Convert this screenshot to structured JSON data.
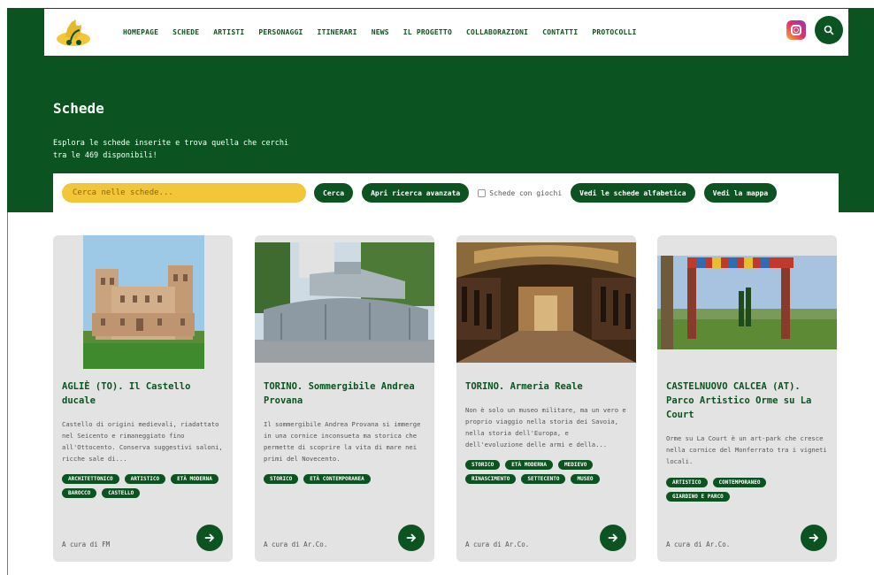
{
  "nav": {
    "items": [
      "HOMEPAGE",
      "SCHEDE",
      "ARTISTI",
      "PERSONAGGI",
      "ITINERARI",
      "NEWS",
      "IL PROGETTO",
      "COLLABORAZIONI",
      "CONTATTI",
      "PROTOCOLLI"
    ]
  },
  "hero": {
    "title": "Schede",
    "description": "Esplora le schede inserite e trova quella che cerchi tra le 469 disponibili!"
  },
  "toolbar": {
    "search_placeholder": "Cerca nelle schede...",
    "search_button": "Cerca",
    "advanced_button": "Apri ricerca avanzata",
    "checkbox_label": "Schede con giochi",
    "alpha_button": "Vedi le schede alfabetica",
    "map_button": "Vedi la mappa"
  },
  "cards": [
    {
      "title": "AGLIÈ (TO). Il Castello ducale",
      "text": "Castello di origini medievali, riadattato nel Seicento e rimaneggiato fino all'Ottocento. Conserva suggestivi saloni, ricche sale di...",
      "tags": [
        "ARCHITETTONICO",
        "ARTISTICO",
        "ETÀ MODERNA",
        "BAROCCO",
        "CASTELLO"
      ],
      "author": "A cura di FM"
    },
    {
      "title": "TORINO. Sommergibile Andrea Provana",
      "text": "Il sommergibile Andrea Provana si immerge in una cornice inconsueta ma storica che permette di scoprire la vita di mare nei primi del Novecento.",
      "tags": [
        "STORICO",
        "ETÀ CONTEMPORANEA"
      ],
      "author": "A cura di Ar.Co."
    },
    {
      "title": "TORINO. Armeria Reale",
      "text": "Non è solo un museo militare, ma un vero e proprio viaggio nella storia dei Savoia, nella storia dell'Europa, e dell'evoluzione delle armi e della...",
      "tags": [
        "STORICO",
        "ETÀ MODERNA",
        "MEDIEVO",
        "RINASCIMENTO",
        "SETTECENTO",
        "MUSEO"
      ],
      "author": "A cura di Ar.Co."
    },
    {
      "title": "CASTELNUOVO CALCEA (AT). Parco Artistico Orme su La Court",
      "text": "Orme su La Court è un art-park che cresce nella cornice del Monferrato tra i vigneti locali.",
      "tags": [
        "ARTISTICO",
        "CONTEMPORANEO",
        "GIARDINO E PARCO"
      ],
      "author": "A cura di Ar.Co."
    }
  ],
  "colors": {
    "primary": "#0b5320",
    "accent": "#f3c63a",
    "card_bg": "#e3e3e3"
  },
  "icons": [
    "logo-icon",
    "instagram-icon",
    "search-icon",
    "arrow-right-icon"
  ]
}
